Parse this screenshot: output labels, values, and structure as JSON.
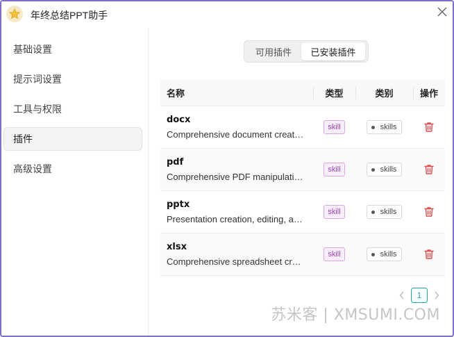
{
  "window": {
    "title": "年终总结PPT助手"
  },
  "colors": {
    "accent": "#1aa89a",
    "danger": "#e24a4a",
    "border": "#7b6fd0",
    "skill_badge": "#9a3fb3"
  },
  "sidebar": {
    "items": [
      {
        "label": "基础设置"
      },
      {
        "label": "提示词设置"
      },
      {
        "label": "工具与权限"
      },
      {
        "label": "插件",
        "active": true
      },
      {
        "label": "高级设置"
      }
    ]
  },
  "tabs": [
    {
      "label": "可用插件"
    },
    {
      "label": "已安装插件",
      "active": true
    }
  ],
  "table": {
    "headers": {
      "name": "名称",
      "type": "类型",
      "category": "类别",
      "action": "操作"
    },
    "rows": [
      {
        "name": "docx",
        "description": "Comprehensive document creation, editing",
        "type": "skill",
        "category": "skills"
      },
      {
        "name": "pdf",
        "description": "Comprehensive PDF manipulation toolkit",
        "type": "skill",
        "category": "skills"
      },
      {
        "name": "pptx",
        "description": "Presentation creation, editing, and analysis",
        "type": "skill",
        "category": "skills"
      },
      {
        "name": "xlsx",
        "description": "Comprehensive spreadsheet creation, editing",
        "type": "skill",
        "category": "skills"
      }
    ]
  },
  "pagination": {
    "current": "1"
  },
  "watermark": "苏米客 | XMSUMI.COM"
}
